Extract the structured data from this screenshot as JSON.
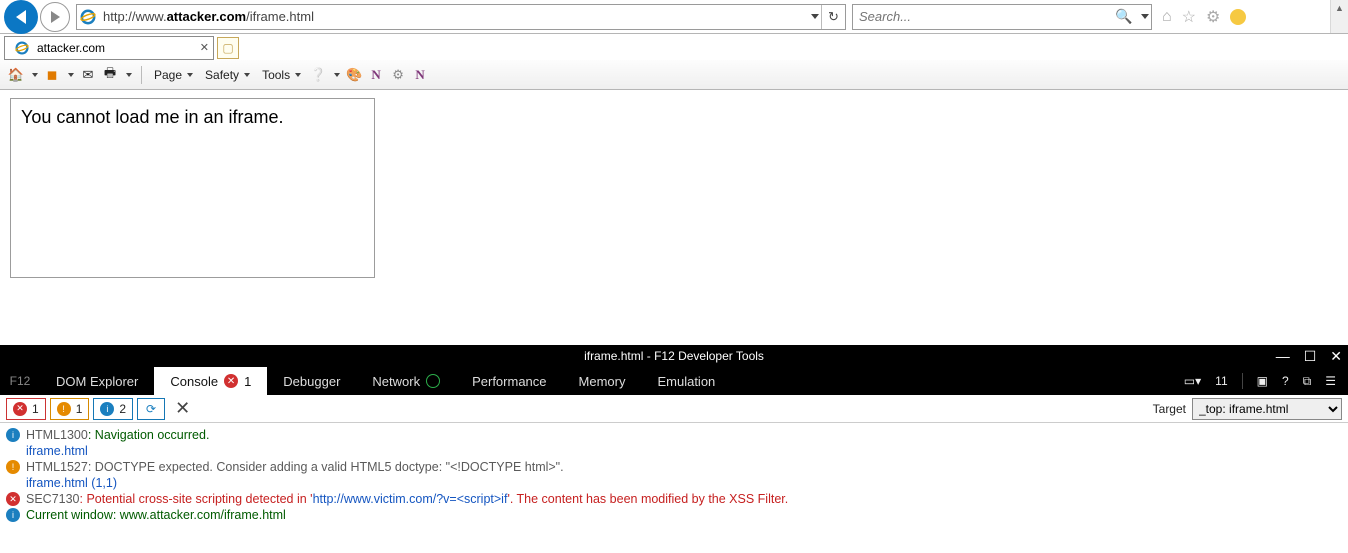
{
  "nav": {
    "url_prefix": "http://www.",
    "url_bold": "attacker.com",
    "url_suffix": "/iframe.html",
    "search_placeholder": "Search..."
  },
  "tab": {
    "title": "attacker.com"
  },
  "cmdbar": {
    "page": "Page",
    "safety": "Safety",
    "tools": "Tools"
  },
  "page": {
    "iframe_text": "You cannot load me in an iframe."
  },
  "devtools": {
    "title": "iframe.html - F12 Developer Tools",
    "f12": "F12",
    "tabs": {
      "dom": "DOM Explorer",
      "console": "Console",
      "console_badge": "1",
      "debugger": "Debugger",
      "network": "Network",
      "performance": "Performance",
      "memory": "Memory",
      "emulation": "Emulation"
    },
    "right": {
      "count": "11",
      "q": "?"
    },
    "toolbar": {
      "err": "1",
      "warn": "1",
      "info": "2",
      "target_label": "Target",
      "target_value": "_top: iframe.html"
    },
    "msg1": {
      "code": "HTML1300",
      "text": ": Navigation occurred.",
      "src": "iframe.html"
    },
    "msg2": {
      "code": "HTML1527",
      "text": ": DOCTYPE expected. Consider adding a valid HTML5 doctype: \"<!DOCTYPE html>\".",
      "src": "iframe.html (1,1)"
    },
    "msg3": {
      "code": "SEC7130",
      "pre": ": Potential cross-site scripting detected in '",
      "url": "http://www.victim.com/?v=<script>if",
      "post": "'. The content has been modified by the XSS Filter."
    },
    "msg4": {
      "text": "Current window: www.attacker.com/iframe.html"
    }
  }
}
